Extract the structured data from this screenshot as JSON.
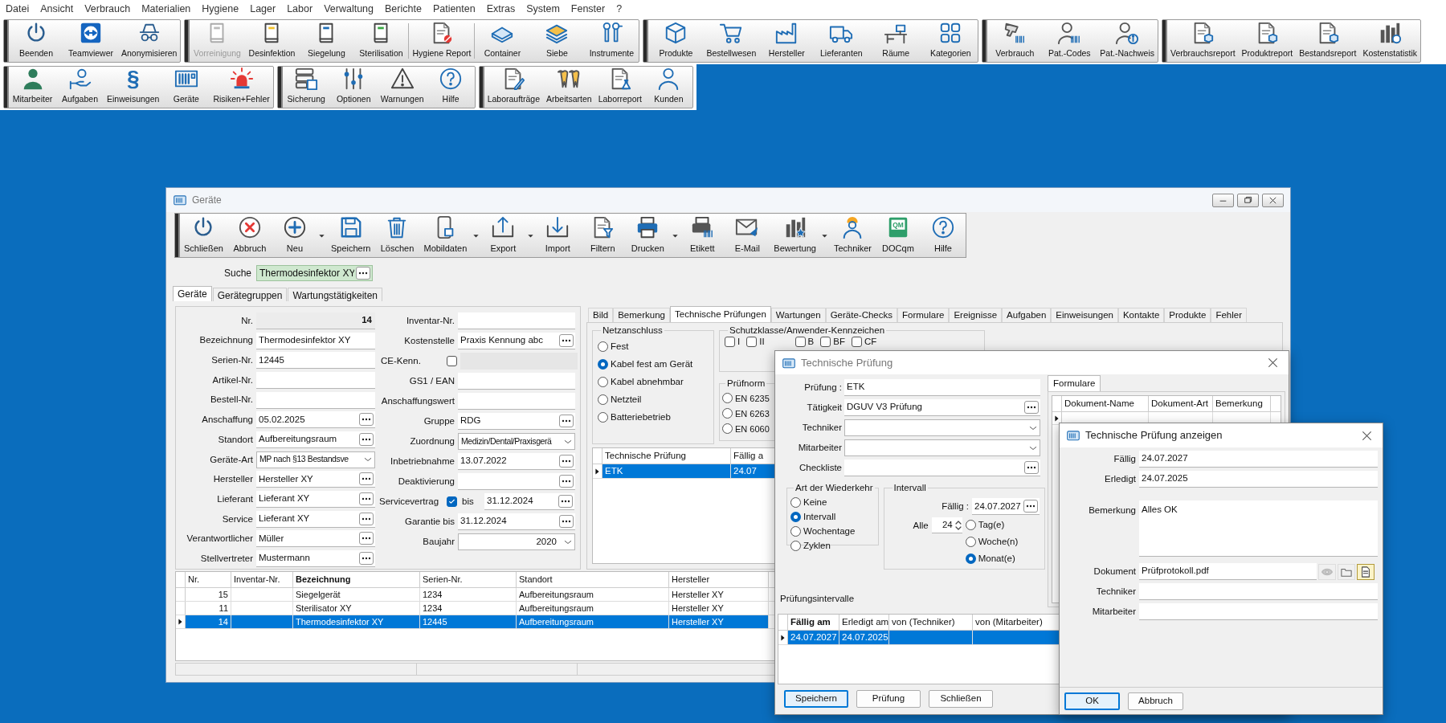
{
  "menu_bar": {
    "items": [
      "Datei",
      "Ansicht",
      "Verbrauch",
      "Materialien",
      "Hygiene",
      "Lager",
      "Labor",
      "Verwaltung",
      "Berichte",
      "Patienten",
      "Extras",
      "System",
      "Fenster",
      "?"
    ]
  },
  "main_toolbar": {
    "rows": [
      {
        "groups": [
          {
            "sections": [
              [
                {
                  "label": "Beenden",
                  "disabled": false
                },
                {
                  "label": "Teamviewer",
                  "disabled": false
                },
                {
                  "label": "Anonymisieren",
                  "disabled": false
                }
              ]
            ]
          },
          {
            "sections": [
              [
                {
                  "label": "Vorreinigung",
                  "disabled": true
                },
                {
                  "label": "Desinfektion",
                  "disabled": false
                },
                {
                  "label": "Siegelung",
                  "disabled": false
                },
                {
                  "label": "Sterilisation",
                  "disabled": false
                }
              ],
              [
                {
                  "label": "Hygiene Report",
                  "disabled": false
                }
              ],
              [
                {
                  "label": "Container",
                  "disabled": false
                },
                {
                  "label": "Siebe",
                  "disabled": false
                },
                {
                  "label": "Instrumente",
                  "disabled": false
                }
              ]
            ]
          },
          {
            "sections": [
              [
                {
                  "label": "Produkte",
                  "disabled": false
                },
                {
                  "label": "Bestellwesen",
                  "disabled": false
                },
                {
                  "label": "Hersteller",
                  "disabled": false
                },
                {
                  "label": "Lieferanten",
                  "disabled": false
                },
                {
                  "label": "Räume",
                  "disabled": false
                },
                {
                  "label": "Kategorien",
                  "disabled": false
                }
              ]
            ]
          },
          {
            "sections": [
              [
                {
                  "label": "Verbrauch",
                  "disabled": false
                },
                {
                  "label": "Pat.-Codes",
                  "disabled": false
                },
                {
                  "label": "Pat.-Nachweis",
                  "disabled": false
                }
              ]
            ]
          },
          {
            "sections": [
              [
                {
                  "label": "Verbrauchsreport",
                  "disabled": false
                },
                {
                  "label": "Produktreport",
                  "disabled": false
                },
                {
                  "label": "Bestandsreport",
                  "disabled": false
                },
                {
                  "label": "Kostenstatistik",
                  "disabled": false
                }
              ]
            ]
          }
        ]
      },
      {
        "groups": [
          {
            "sections": [
              [
                {
                  "label": "Mitarbeiter",
                  "disabled": false
                },
                {
                  "label": "Aufgaben",
                  "disabled": false
                },
                {
                  "label": "Einweisungen",
                  "disabled": false,
                  "icon_text": "§"
                },
                {
                  "label": "Geräte",
                  "disabled": false
                },
                {
                  "label": "Risiken+Fehler",
                  "disabled": false
                }
              ]
            ]
          },
          {
            "sections": [
              [
                {
                  "label": "Sicherung",
                  "disabled": false
                },
                {
                  "label": "Optionen",
                  "disabled": false
                },
                {
                  "label": "Warnungen",
                  "disabled": false
                },
                {
                  "label": "Hilfe",
                  "disabled": false
                }
              ]
            ]
          },
          {
            "sections": [
              [
                {
                  "label": "Laboraufträge",
                  "disabled": false
                },
                {
                  "label": "Arbeitsarten",
                  "disabled": false
                },
                {
                  "label": "Laborreport",
                  "disabled": false
                },
                {
                  "label": "Kunden",
                  "disabled": false
                }
              ]
            ]
          }
        ]
      }
    ]
  },
  "devices_window": {
    "title": "Geräte",
    "toolbar": [
      {
        "label": "Schließen",
        "dropdown": false
      },
      {
        "label": "Abbruch",
        "dropdown": false
      },
      {
        "label": "Neu",
        "dropdown": true
      },
      {
        "label": "Speichern",
        "dropdown": false
      },
      {
        "label": "Löschen",
        "dropdown": false
      },
      {
        "label": "Mobildaten",
        "dropdown": true
      },
      {
        "label": "Export",
        "dropdown": true
      },
      {
        "label": "Import",
        "dropdown": false
      },
      {
        "label": "Filtern",
        "dropdown": false
      },
      {
        "label": "Drucken",
        "dropdown": true
      },
      {
        "label": "Etikett",
        "dropdown": false
      },
      {
        "label": "E-Mail",
        "dropdown": false
      },
      {
        "label": "Bewertung",
        "dropdown": true
      },
      {
        "label": "Techniker",
        "dropdown": false
      },
      {
        "label": "DOCqm",
        "dropdown": false,
        "icon_text": "QM"
      },
      {
        "label": "Hilfe",
        "dropdown": false
      }
    ],
    "search": {
      "label": "Suche",
      "value": "Thermodesinfektor XY"
    },
    "tabs": [
      {
        "label": "Geräte",
        "selected": true
      },
      {
        "label": "Gerätegruppen",
        "selected": false
      },
      {
        "label": "Wartungstätigkeiten",
        "selected": false
      }
    ],
    "form_left": [
      {
        "label": "Nr.",
        "value": "14",
        "kind": "readonly"
      },
      {
        "label": "Bezeichnung",
        "value": "Thermodesinfektor XY",
        "kind": "text"
      },
      {
        "label": "Serien-Nr.",
        "value": "12445",
        "kind": "text"
      },
      {
        "label": "Artikel-Nr.",
        "kind": "text"
      },
      {
        "label": "Bestell-Nr.",
        "kind": "text"
      },
      {
        "label": "Anschaffung",
        "value": "05.02.2025",
        "kind": "picker"
      },
      {
        "label": "Standort",
        "value": "Aufbereitungsraum",
        "kind": "picker"
      },
      {
        "label": "Geräte-Art",
        "value": "MP nach §13 Bestandsve",
        "kind": "select"
      },
      {
        "label": "Hersteller",
        "value": "Hersteller XY",
        "kind": "picker"
      },
      {
        "label": "Lieferant",
        "value": "Lieferant XY",
        "kind": "picker"
      },
      {
        "label": "Service",
        "value": "Lieferant XY",
        "kind": "picker"
      },
      {
        "label": "Verantwortlicher",
        "value": "Müller",
        "kind": "picker"
      },
      {
        "label": "Stellvertreter",
        "value": "Mustermann",
        "kind": "picker"
      }
    ],
    "form_right": [
      {
        "label": "Inventar-Nr.",
        "kind": "text"
      },
      {
        "label": "Kostenstelle",
        "value": "Praxis Kennung abc",
        "kind": "picker"
      },
      {
        "label": "CE-Kenn.",
        "kind": "checkbox",
        "checked": false
      },
      {
        "label": "GS1 / EAN",
        "kind": "text"
      },
      {
        "label": "Anschaffungswert",
        "kind": "text"
      },
      {
        "label": "Gruppe",
        "value": "RDG",
        "kind": "picker"
      },
      {
        "label": "Zuordnung",
        "value": "Medizin/Dental/Praxisgerä",
        "kind": "select"
      },
      {
        "label": "Inbetriebnahme",
        "value": "13.07.2022",
        "kind": "picker"
      },
      {
        "label": "Deaktivierung",
        "kind": "picker"
      },
      {
        "label": "Servicevertrag",
        "kind": "contract",
        "checked": true,
        "until_label": "bis",
        "value": "31.12.2024"
      },
      {
        "label": "Garantie bis",
        "value": "31.12.2024",
        "kind": "picker"
      },
      {
        "label": "Baujahr",
        "value": "2020",
        "kind": "number_select"
      }
    ],
    "detail_tabs": [
      {
        "label": "Bild",
        "selected": false
      },
      {
        "label": "Bemerkung",
        "selected": false
      },
      {
        "label": "Technische Prüfungen",
        "selected": true
      },
      {
        "label": "Wartungen",
        "selected": false
      },
      {
        "label": "Geräte-Checks",
        "selected": false
      },
      {
        "label": "Formulare",
        "selected": false
      },
      {
        "label": "Ereignisse",
        "selected": false
      },
      {
        "label": "Aufgaben",
        "selected": false
      },
      {
        "label": "Einweisungen",
        "selected": false
      },
      {
        "label": "Kontakte",
        "selected": false
      },
      {
        "label": "Produkte",
        "selected": false
      },
      {
        "label": "Fehler",
        "selected": false
      }
    ],
    "power_supply": {
      "title": "Netzanschluss",
      "options": [
        {
          "label": "Fest",
          "selected": false
        },
        {
          "label": "Kabel fest am Gerät",
          "selected": true
        },
        {
          "label": "Kabel abnehmbar",
          "selected": false
        },
        {
          "label": "Netzteil",
          "selected": false
        },
        {
          "label": "Batteriebetrieb",
          "selected": false
        }
      ]
    },
    "protection_class": {
      "title": "Schutzklasse/Anwender-Kennzeichen",
      "options": [
        {
          "label": "I",
          "checked": false
        },
        {
          "label": "II",
          "checked": false
        },
        {
          "label": "B",
          "checked": false
        },
        {
          "label": "BF",
          "checked": false
        },
        {
          "label": "CF",
          "checked": false
        }
      ]
    },
    "test_standard": {
      "title": "Prüfnorm",
      "options": [
        {
          "label": "EN 6235",
          "selected": false
        },
        {
          "label": "EN 6263",
          "selected": false
        },
        {
          "label": "EN 6060",
          "selected": false
        }
      ]
    },
    "inspections_table": {
      "columns": [
        {
          "label": "Technische Prüfung",
          "sorted": false
        },
        {
          "label": "Fällig a",
          "sorted": false
        }
      ],
      "rows": [
        {
          "cells": [
            "ETK",
            "24.07"
          ],
          "selected": true,
          "current": true
        }
      ]
    },
    "devices_table": {
      "columns": [
        {
          "label": "Nr.",
          "sorted": false
        },
        {
          "label": "Inventar-Nr.",
          "sorted": false
        },
        {
          "label": "Bezeichnung",
          "sorted": true
        },
        {
          "label": "Serien-Nr.",
          "sorted": false
        },
        {
          "label": "Standort",
          "sorted": false
        },
        {
          "label": "Hersteller",
          "sorted": false
        }
      ],
      "rows": [
        {
          "cells": [
            "15",
            "",
            "Siegelgerät",
            "1234",
            "Aufbereitungsraum",
            "Hersteller XY"
          ],
          "selected": false,
          "current": false
        },
        {
          "cells": [
            "11",
            "",
            "Sterilisator XY",
            "1234",
            "Aufbereitungsraum",
            "Hersteller XY"
          ],
          "selected": false,
          "current": false
        },
        {
          "cells": [
            "14",
            "",
            "Thermodesinfektor XY",
            "12445",
            "Aufbereitungsraum",
            "Hersteller XY"
          ],
          "selected": true,
          "current": true
        }
      ]
    }
  },
  "inspection_dialog": {
    "title": "Technische Prüfung",
    "fields": [
      {
        "label": "Prüfung :",
        "value": "ETK",
        "kind": "text"
      },
      {
        "label": "Tätigkeit",
        "value": "DGUV V3 Prüfung",
        "kind": "picker"
      },
      {
        "label": "Techniker",
        "kind": "select"
      },
      {
        "label": "Mitarbeiter",
        "kind": "select"
      },
      {
        "label": "Checkliste",
        "kind": "picker"
      }
    ],
    "recurrence": {
      "title": "Art der Wiederkehr",
      "options": [
        {
          "label": "Keine",
          "selected": false
        },
        {
          "label": "Intervall",
          "selected": true
        },
        {
          "label": "Wochentage",
          "selected": false
        },
        {
          "label": "Zyklen",
          "selected": false
        }
      ]
    },
    "interval": {
      "title": "Intervall",
      "due_label": "Fällig :",
      "due": "24.07.2027",
      "every_label": "Alle",
      "every": "24",
      "units": [
        {
          "label": "Tag(e)",
          "selected": false
        },
        {
          "label": "Woche(n)",
          "selected": false
        },
        {
          "label": "Monat(e)",
          "selected": true
        }
      ]
    },
    "forms_tab": {
      "label": "Formulare",
      "selected": true
    },
    "forms_table": {
      "columns": [
        {
          "label": "Dokument-Name",
          "sorted": false
        },
        {
          "label": "Dokument-Art",
          "sorted": false
        },
        {
          "label": "Bemerkung",
          "sorted": false
        }
      ],
      "rows": [
        {
          "current": true
        }
      ]
    },
    "intervals_label": "Prüfungsintervalle",
    "intervals_table": {
      "columns": [
        {
          "label": "Fällig am",
          "sorted": true
        },
        {
          "label": "Erledigt am",
          "sorted": false
        },
        {
          "label": "von (Techniker)",
          "sorted": false
        },
        {
          "label": "von (Mitarbeiter)",
          "sorted": false
        }
      ],
      "rows": [
        {
          "cells": [
            "24.07.2027",
            "24.07.2025",
            "",
            ""
          ],
          "selected": true,
          "current": true
        }
      ]
    },
    "buttons": [
      {
        "label": "Speichern",
        "default": true
      },
      {
        "label": "Prüfung",
        "default": false
      },
      {
        "label": "Schließen",
        "default": false
      }
    ]
  },
  "inspection_view_dialog": {
    "title": "Technische Prüfung anzeigen",
    "fields": [
      {
        "label": "Fällig",
        "value": "24.07.2027",
        "kind": "text"
      },
      {
        "label": "Erledigt",
        "value": "24.07.2025",
        "kind": "text"
      },
      {
        "label": "Bemerkung",
        "value": "Alles OK",
        "kind": "memo"
      },
      {
        "label": "Dokument",
        "value": "Prüfprotokoll.pdf",
        "kind": "document"
      },
      {
        "label": "Techniker",
        "kind": "text"
      },
      {
        "label": "Mitarbeiter",
        "kind": "text"
      }
    ],
    "buttons": [
      {
        "label": "OK",
        "default": true
      },
      {
        "label": "Abbruch",
        "default": false
      }
    ]
  }
}
